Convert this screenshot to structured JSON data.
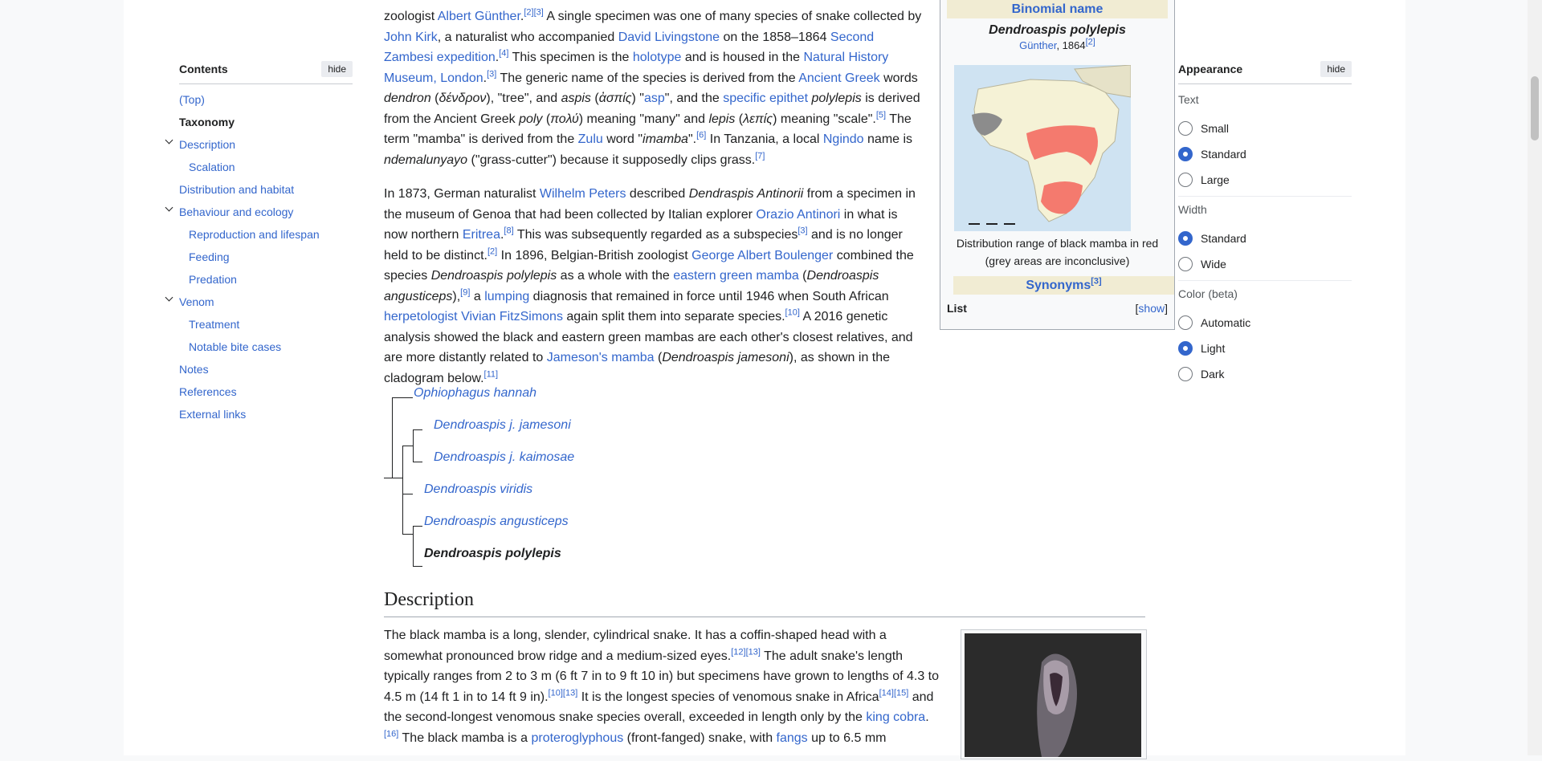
{
  "toc": {
    "title": "Contents",
    "hide_label": "hide",
    "items": [
      {
        "label": "(Top)"
      },
      {
        "label": "Taxonomy"
      },
      {
        "label": "Description"
      },
      {
        "label": "Scalation"
      },
      {
        "label": "Distribution and habitat"
      },
      {
        "label": "Behaviour and ecology"
      },
      {
        "label": "Reproduction and lifespan"
      },
      {
        "label": "Feeding"
      },
      {
        "label": "Predation"
      },
      {
        "label": "Venom"
      },
      {
        "label": "Treatment"
      },
      {
        "label": "Notable bite cases"
      },
      {
        "label": "Notes"
      },
      {
        "label": "References"
      },
      {
        "label": "External links"
      }
    ]
  },
  "infobox": {
    "binomial_header": "Binomial name",
    "binomial": "Dendroaspis polylepis",
    "authority_link": "Günther",
    "authority_year": ", 1864",
    "authority_ref": "[2]",
    "caption": "Distribution range of black mamba in red (grey areas are inconclusive)",
    "synonyms_header": "Synonyms",
    "synonyms_ref": "[3]",
    "list_label": "List",
    "show_label": "show"
  },
  "cladogram": {
    "taxa": [
      "Ophiophagus hannah",
      "Dendroaspis j. jamesoni",
      "Dendroaspis j. kaimosae",
      "Dendroaspis viridis",
      "Dendroaspis angusticeps",
      "Dendroaspis polylepis"
    ]
  },
  "description": {
    "heading": "Description"
  },
  "appearance": {
    "title": "Appearance",
    "hide_label": "hide",
    "text_label": "Text",
    "text_options": [
      "Small",
      "Standard",
      "Large"
    ],
    "width_label": "Width",
    "width_options": [
      "Standard",
      "Wide"
    ],
    "color_label": "Color (beta)",
    "color_options": [
      "Automatic",
      "Light",
      "Dark"
    ]
  },
  "colors": {
    "link": "#3366cc",
    "infobox_header": "#f1ecd3",
    "range_red": "#f47a6e"
  }
}
